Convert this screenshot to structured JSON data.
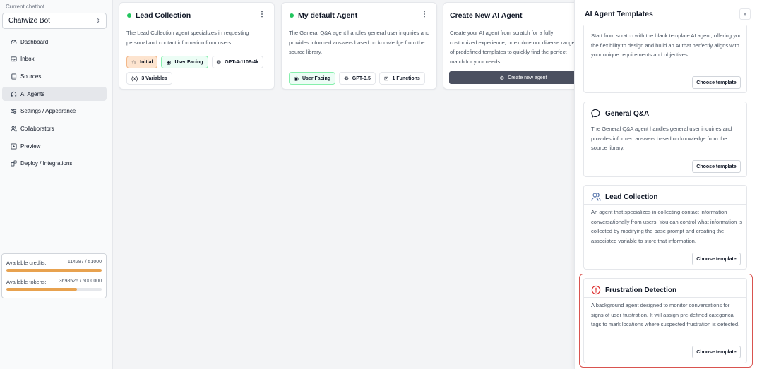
{
  "sidebar": {
    "current_label": "Current chatbot",
    "selected_bot": "Chatwize Bot",
    "items": [
      {
        "label": "Dashboard",
        "icon": "gauge-icon"
      },
      {
        "label": "Inbox",
        "icon": "inbox-icon"
      },
      {
        "label": "Sources",
        "icon": "file-icon"
      },
      {
        "label": "AI Agents",
        "icon": "headset-icon",
        "active": true
      },
      {
        "label": "Settings / Appearance",
        "icon": "sliders-icon"
      },
      {
        "label": "Collaborators",
        "icon": "users-icon"
      },
      {
        "label": "Preview",
        "icon": "play-icon"
      },
      {
        "label": "Deploy / Integrations",
        "icon": "plug-icon"
      }
    ],
    "credits": {
      "credits_label": "Available credits:",
      "credits_value": "114287 / 51000",
      "credits_fraction": 1.0,
      "tokens_label": "Available tokens:",
      "tokens_value": "3698526 / 5000000",
      "tokens_fraction": 0.74
    }
  },
  "cards": [
    {
      "title": "Lead Collection",
      "description": "The Lead Collection agent specializes in requesting personal and contact information from users.",
      "badges": [
        "Initial",
        "User Facing",
        "GPT-4-1106-4k",
        "3 Variables"
      ]
    },
    {
      "title": "My default Agent",
      "description": "The General Q&A agent handles general user inquiries and provides informed answers based on knowledge from the source library.",
      "badges": [
        "User Facing",
        "GPT-3.5",
        "1 Functions"
      ]
    },
    {
      "title": "Create New AI Agent",
      "description": "Create your AI agent from scratch for a fully customized experience, or explore our diverse range of predefined templates to quickly find the perfect match for your needs.",
      "button": "Create new agent"
    }
  ],
  "panel": {
    "title": "AI Agent Templates",
    "close": "×",
    "templates": [
      {
        "title": "",
        "description": "Start from scratch with the blank template AI agent, offering you the flexibility to design and build an AI that perfectly aligns with your unique requirements and objectives.",
        "button": "Choose template"
      },
      {
        "title": "General Q&A",
        "icon": "chat-bubble-icon",
        "description": "The General Q&A agent handles general user inquiries and provides informed answers based on knowledge from the source library.",
        "button": "Choose template"
      },
      {
        "title": "Lead Collection",
        "icon": "users-icon",
        "description": "An agent that specializes in collecting contact information conversationally from users. You can control what information is collected by modifying the base prompt and creating the associated variable to store that information.",
        "button": "Choose template"
      },
      {
        "title": "Frustration Detection",
        "icon": "alert-circle-icon",
        "description": "A background agent designed to monitor conversations for signs of user frustration. It will assign pre-defined categorical tags to mark locations where suspected frustration is detected.",
        "button": "Choose template"
      }
    ]
  },
  "colors": {
    "accent_orange": "#e8a24f",
    "status_green": "#22c55e",
    "highlight_red": "#d9534f",
    "dark_button": "#4b5060"
  }
}
